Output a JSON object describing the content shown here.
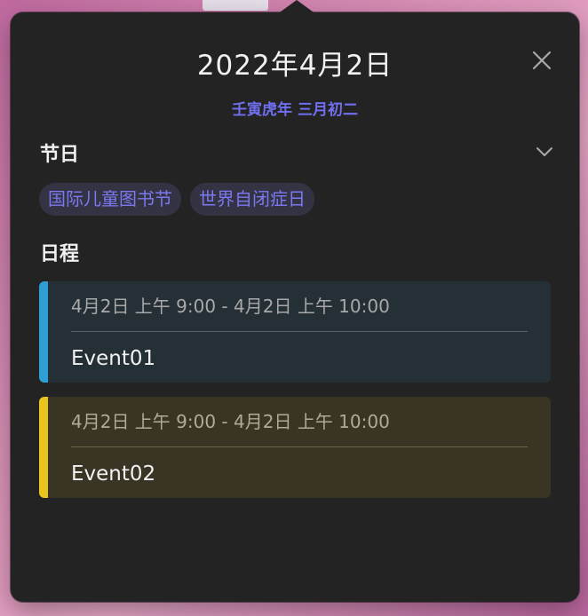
{
  "popover": {
    "date_title": "2022年4月2日",
    "lunar_date": "壬寅虎年 三月初二",
    "close_icon": "close-icon",
    "holidays": {
      "title": "节日",
      "toggle_icon": "chevron-down-icon",
      "tags": [
        "国际儿童图书节",
        "世界自闭症日"
      ]
    },
    "schedule": {
      "title": "日程",
      "events": [
        {
          "time": "4月2日 上午 9:00 - 4月2日 上午 10:00",
          "title": "Event01",
          "color": "#2d9fd4"
        },
        {
          "time": "4月2日 上午 9:00 - 4月2日 上午 10:00",
          "title": "Event02",
          "color": "#e9c61f"
        }
      ]
    }
  }
}
